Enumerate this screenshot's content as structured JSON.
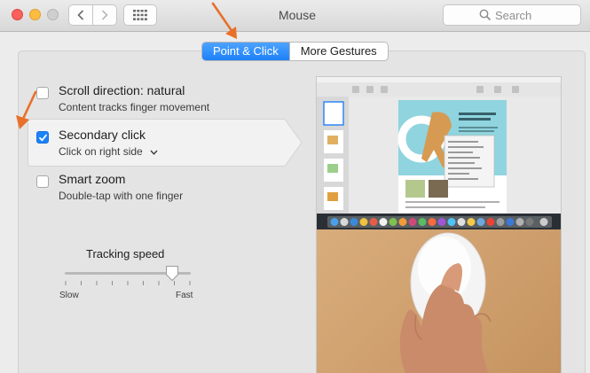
{
  "window": {
    "title": "Mouse"
  },
  "search": {
    "placeholder": "Search"
  },
  "tabs": [
    {
      "label": "Point & Click",
      "active": true
    },
    {
      "label": "More Gestures",
      "active": false
    }
  ],
  "options": [
    {
      "title": "Scroll direction: natural",
      "subtitle": "Content tracks finger movement",
      "checked": false
    },
    {
      "title": "Secondary click",
      "subtitle": "Click on right side",
      "checked": true,
      "has_dropdown": true
    },
    {
      "title": "Smart zoom",
      "subtitle": "Double-tap with one finger",
      "checked": false
    }
  ],
  "tracking": {
    "title": "Tracking speed",
    "slow_label": "Slow",
    "fast_label": "Fast",
    "value_fraction": 0.85
  },
  "colors": {
    "accent": "#1a82fb",
    "annotation_arrow": "#e8702a"
  },
  "icons": {
    "back": "chevron-left-icon",
    "forward": "chevron-right-icon",
    "show_all": "grid-icon",
    "search": "magnifier-icon"
  }
}
